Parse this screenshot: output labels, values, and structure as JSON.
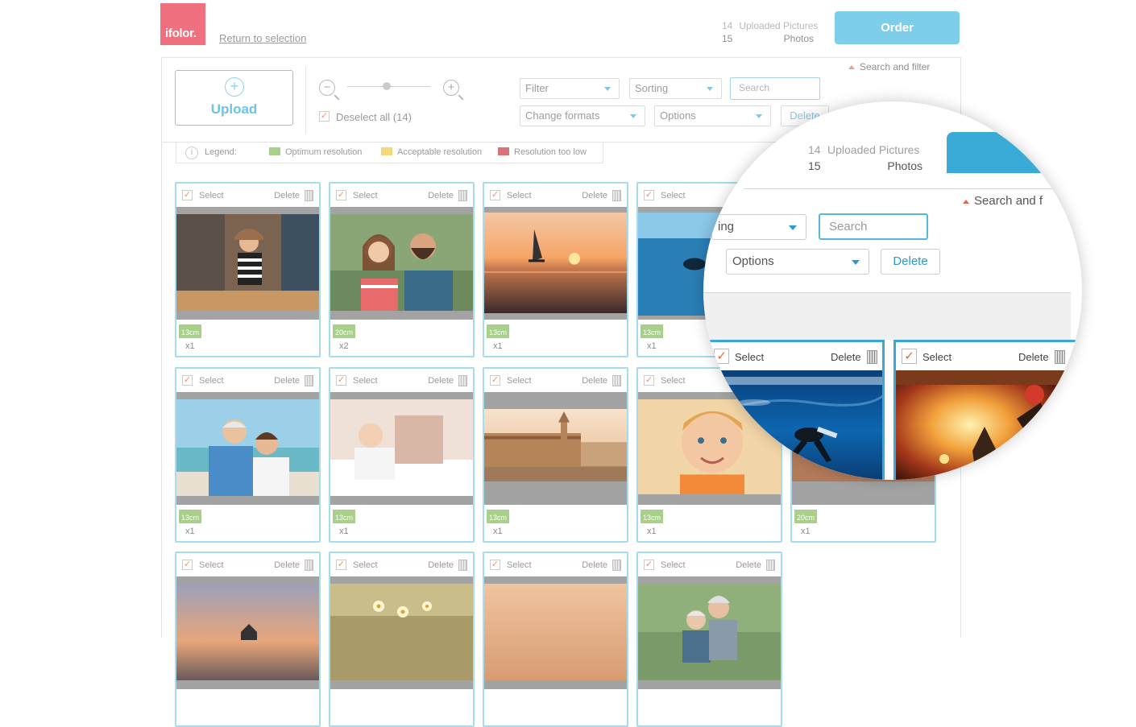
{
  "header": {
    "logo_text": "ifolor.",
    "return_link": "Return to selection",
    "uploaded_count": "14",
    "uploaded_label": "Uploaded Pictures",
    "photos_count": "15",
    "photos_label": "Photos",
    "order_label": "Order"
  },
  "toolbar": {
    "upload_label": "Upload",
    "deselect_label": "Deselect all (14)",
    "filter_label": "Filter",
    "sorting_label": "Sorting",
    "search_placeholder": "Search",
    "change_formats_label": "Change formats",
    "options_label": "Options",
    "delete_label": "Delete",
    "search_and_filter": "Search and filter"
  },
  "legend": {
    "title": "Legend:",
    "items": [
      {
        "label": "Optimum resolution",
        "color": "#a8d08a"
      },
      {
        "label": "Acceptable resolution",
        "color": "#f5d77a"
      },
      {
        "label": "Resolution too low",
        "color": "#d8737a"
      }
    ]
  },
  "card_labels": {
    "select": "Select",
    "delete": "Delete"
  },
  "photos": [
    {
      "size": "13cm",
      "qty": "x1",
      "scene": "cafe"
    },
    {
      "size": "20cm",
      "qty": "x2",
      "scene": "couple"
    },
    {
      "size": "13cm",
      "qty": "x1",
      "scene": "sunset"
    },
    {
      "size": "13cm",
      "qty": "x1",
      "scene": "diver"
    },
    {
      "size": "13cm",
      "qty": "x1",
      "scene": "beach"
    },
    {
      "size": "13cm",
      "qty": "x1",
      "scene": "baby"
    },
    {
      "size": "13cm",
      "qty": "x1",
      "scene": "city"
    },
    {
      "size": "13cm",
      "qty": "x1",
      "scene": "boy"
    },
    {
      "size": "20cm",
      "qty": "x1",
      "scene": "roofs"
    },
    {
      "size": "",
      "qty": "",
      "scene": "clouds"
    },
    {
      "size": "",
      "qty": "",
      "scene": "flowers"
    },
    {
      "size": "",
      "qty": "",
      "scene": "wall"
    },
    {
      "size": "",
      "qty": "",
      "scene": "grandparents"
    }
  ],
  "magnifier": {
    "uploaded_count": "14",
    "uploaded_label": "Uploaded Pictures",
    "photos_count": "15",
    "photos_label": "Photos",
    "search_and_filter": "Search and f",
    "sorting_partial": "ing",
    "search_placeholder": "Search",
    "options_label": "Options",
    "delete_label": "Delete",
    "card1_select": "Select",
    "card1_delete": "Delete",
    "card2_select": "Select",
    "card2_delete": "Delete"
  },
  "colors": {
    "accent": "#3aaad7",
    "order_button": "#7dcdeb",
    "logo": "#f07080",
    "checkmark": "#e8663f"
  }
}
